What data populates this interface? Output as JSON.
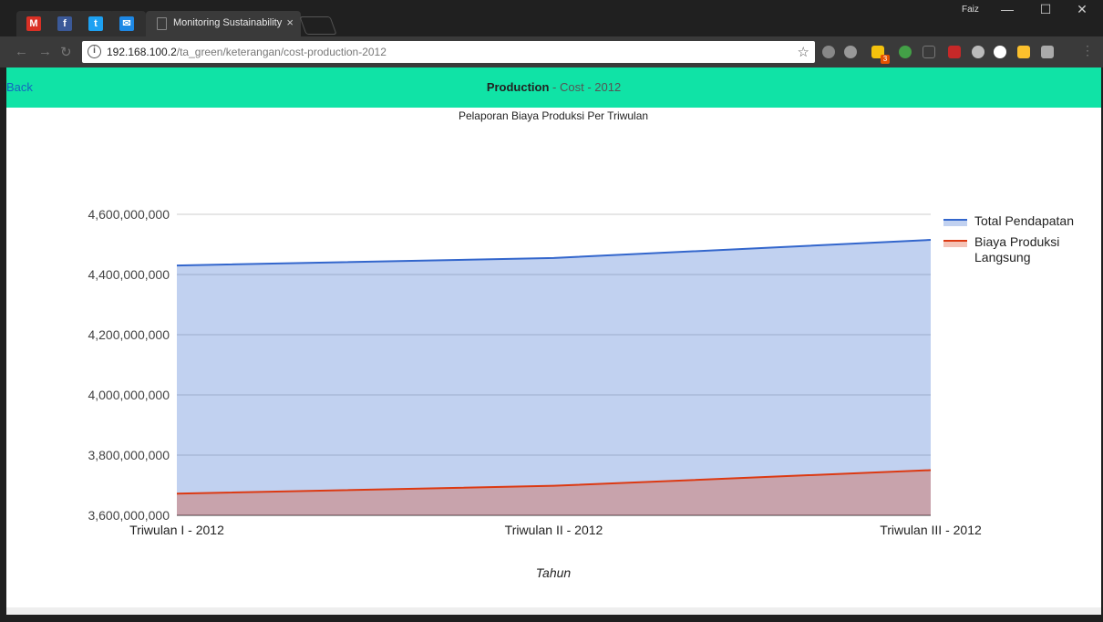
{
  "browser": {
    "tab_title": "Monitoring Sustainability",
    "tab_close": "×",
    "user": "Faiz",
    "win_min": "—",
    "win_max": "☐",
    "win_close": "✕",
    "url_host": "192.168.100.2",
    "url_path": "/ta_green/keterangan/cost-production-2012",
    "extension_badge": "3"
  },
  "page": {
    "back_label": "Back",
    "title_bold": "Production",
    "title_rest": " - Cost - 2012"
  },
  "colors": {
    "header_bg": "#10e3a6",
    "series_blue": "#3366cc",
    "series_red": "#dc3912"
  },
  "chart_data": {
    "type": "area",
    "title": "Pelaporan Biaya Produksi Per Triwulan",
    "xlabel": "Tahun",
    "ylabel": "",
    "categories": [
      "Triwulan I - 2012",
      "Triwulan II - 2012",
      "Triwulan III - 2012"
    ],
    "ylim": [
      3600000000,
      4600000000
    ],
    "yticks": [
      "3,600,000,000",
      "3,800,000,000",
      "4,000,000,000",
      "4,200,000,000",
      "4,400,000,000",
      "4,600,000,000"
    ],
    "ytick_values": [
      3600000000,
      3800000000,
      4000000000,
      4200000000,
      4400000000,
      4600000000
    ],
    "grid": true,
    "legend": "right",
    "series": [
      {
        "name": "Total Pendapatan",
        "values": [
          4430000000,
          4455000000,
          4515000000
        ],
        "color": "#3366cc"
      },
      {
        "name": "Biaya Produksi Langsung",
        "values": [
          3672000000,
          3698000000,
          3750000000
        ],
        "color": "#dc3912"
      }
    ]
  }
}
